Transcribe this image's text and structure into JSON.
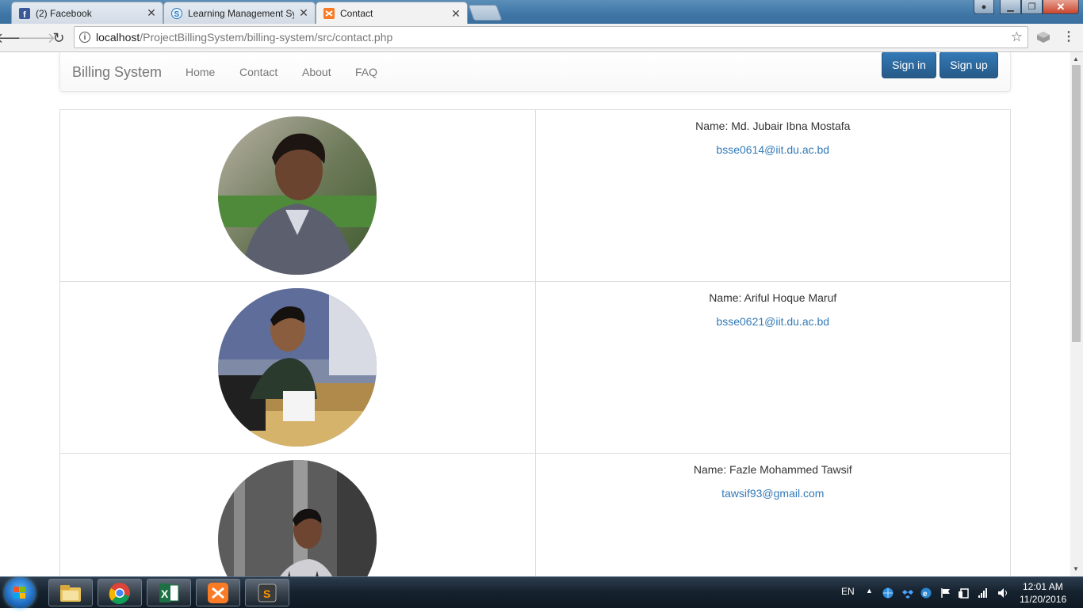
{
  "browser": {
    "tabs": [
      {
        "title": "(2) Facebook",
        "icon": "facebook-icon"
      },
      {
        "title": "Learning Management Sy",
        "icon": "s-logo-icon"
      },
      {
        "title": "Contact",
        "icon": "xampp-icon"
      }
    ],
    "url_host": "localhost",
    "url_path": "/ProjectBillingSystem/billing-system/src/contact.php"
  },
  "navbar": {
    "brand": "Billing System",
    "links": [
      "Home",
      "Contact",
      "About",
      "FAQ"
    ],
    "signin": "Sign in",
    "signup": "Sign up"
  },
  "contacts": [
    {
      "name": "Name: Md. Jubair Ibna Mostafa",
      "email": "bsse0614@iit.du.ac.bd"
    },
    {
      "name": "Name: Ariful Hoque Maruf",
      "email": "bsse0621@iit.du.ac.bd"
    },
    {
      "name": "Name: Fazle Mohammed Tawsif",
      "email": "tawsif93@gmail.com"
    }
  ],
  "taskbar": {
    "apps": [
      "file-explorer-icon",
      "chrome-icon",
      "excel-icon",
      "xampp-icon",
      "sublime-text-icon"
    ],
    "lang": "EN",
    "time": "12:01 AM",
    "date": "11/20/2016"
  },
  "colors": {
    "link": "#337ab7",
    "button": "#2a6aa6"
  }
}
